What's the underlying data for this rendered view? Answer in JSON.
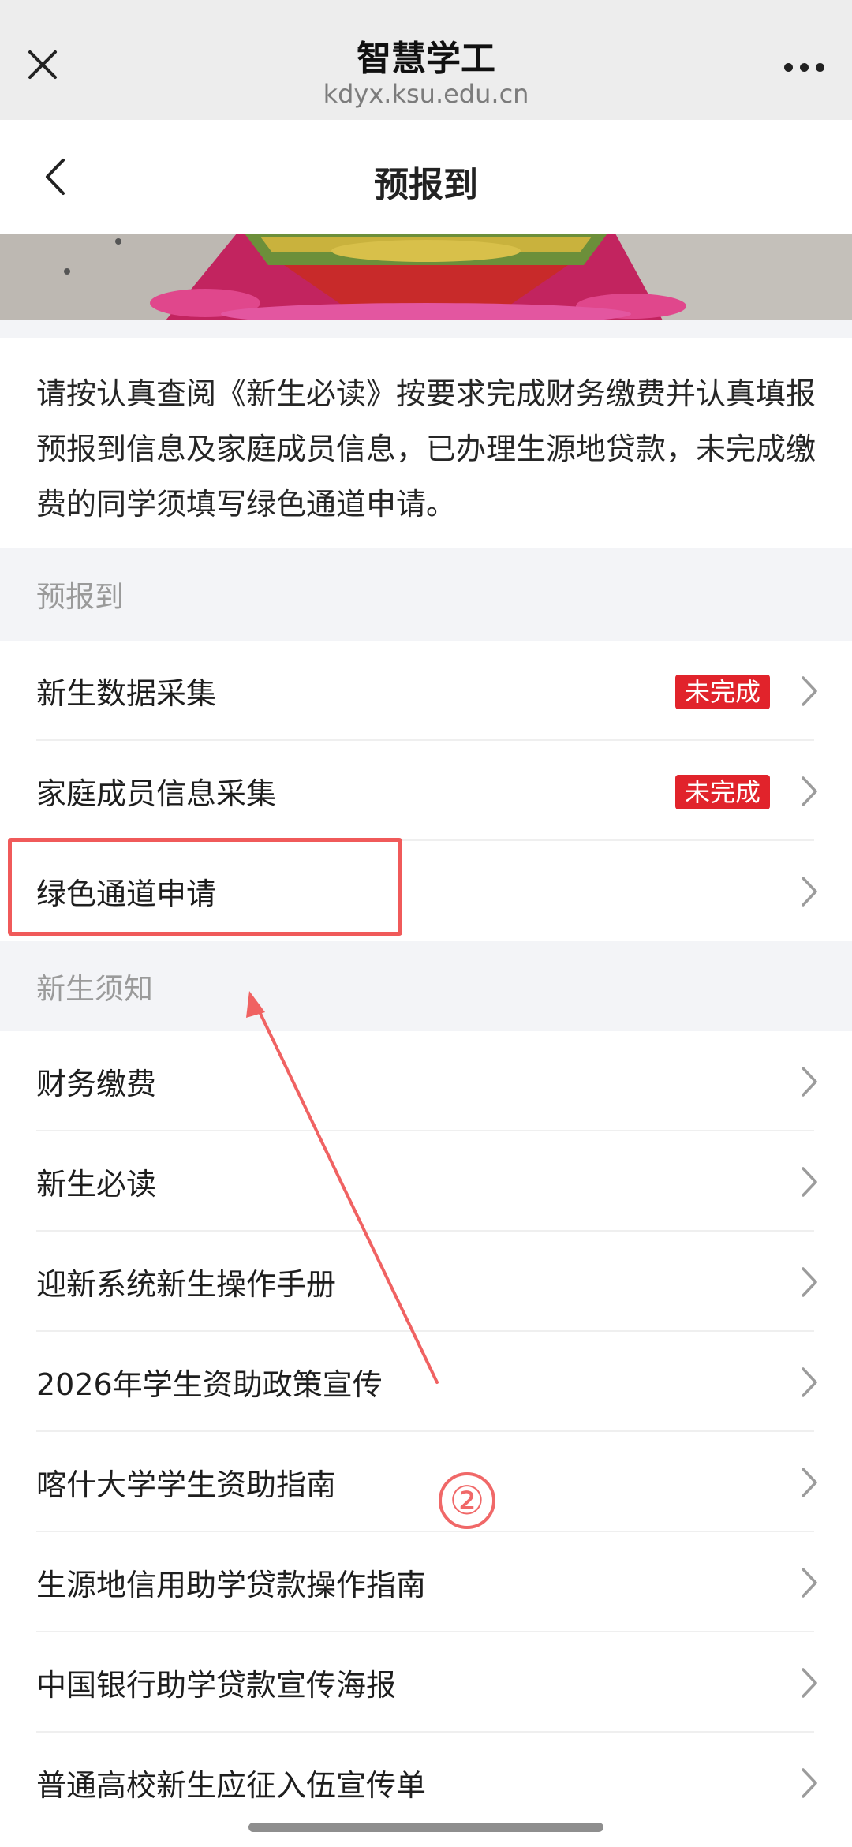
{
  "browser": {
    "title": "智慧学工",
    "url": "kdyx.ksu.edu.cn",
    "close_icon": "close-icon",
    "more_icon": "more-dots-icon"
  },
  "header": {
    "title": "预报到",
    "back_icon": "chevron-left-icon"
  },
  "notice": {
    "text": "请按认真查阅《新生必读》按要求完成财务缴费并认真填报预报到信息及家庭成员信息，已办理生源地贷款，未完成缴费的同学须填写绿色通道申请。"
  },
  "sections": [
    {
      "title": "预报到",
      "items": [
        {
          "label": "新生数据采集",
          "badge": "未完成"
        },
        {
          "label": "家庭成员信息采集",
          "badge": "未完成"
        },
        {
          "label": "绿色通道申请",
          "badge": ""
        }
      ]
    },
    {
      "title": "新生须知",
      "items": [
        {
          "label": "财务缴费"
        },
        {
          "label": "新生必读"
        },
        {
          "label": "迎新系统新生操作手册"
        },
        {
          "label": "2026年学生资助政策宣传"
        },
        {
          "label": "喀什大学学生资助指南"
        },
        {
          "label": "生源地信用助学贷款操作指南"
        },
        {
          "label": "中国银行助学贷款宣传海报"
        },
        {
          "label": "普通高校新生应征入伍宣传单"
        }
      ]
    }
  ],
  "annotation": {
    "step_marker": "②",
    "color": "#f05a5a"
  },
  "colors": {
    "badge": "#e1232b",
    "section_bg": "#f3f4f7",
    "browser_bar": "#ededed"
  }
}
